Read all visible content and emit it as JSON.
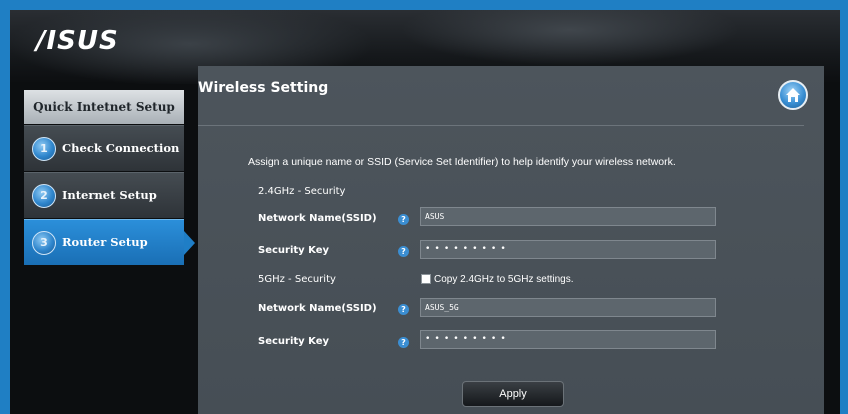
{
  "brand": {
    "logo": "/ISUS"
  },
  "sidebar": {
    "title": "Quick Intetnet Setup",
    "steps": [
      {
        "num": "1",
        "label": "Check Connection"
      },
      {
        "num": "2",
        "label": "Internet Setup"
      },
      {
        "num": "3",
        "label": "Router Setup",
        "active": true
      }
    ]
  },
  "panel": {
    "title": "Wireless Setting",
    "description": "Assign a unique name or SSID (Service Set Identifier) to help identify your wireless network.",
    "band24": {
      "section_label": "2.4GHz - Security",
      "ssid_label": "Network Name(SSID)",
      "ssid_value": "ASUS",
      "key_label": "Security Key",
      "key_value": "•••••••••"
    },
    "band5": {
      "section_label": "5GHz - Security",
      "copy_label": "Copy 2.4GHz to 5GHz settings.",
      "copy_checked": false,
      "ssid_label": "Network Name(SSID)",
      "ssid_value": "ASUS_5G",
      "key_label": "Security Key",
      "key_value": "•••••••••"
    },
    "help_glyph": "?",
    "apply_label": "Apply"
  },
  "icons": {
    "home": "home-icon",
    "help": "help-icon"
  },
  "colors": {
    "accent": "#1f7fc4",
    "panel_bg": "#4d555c",
    "active_step": "#2b8fda"
  }
}
